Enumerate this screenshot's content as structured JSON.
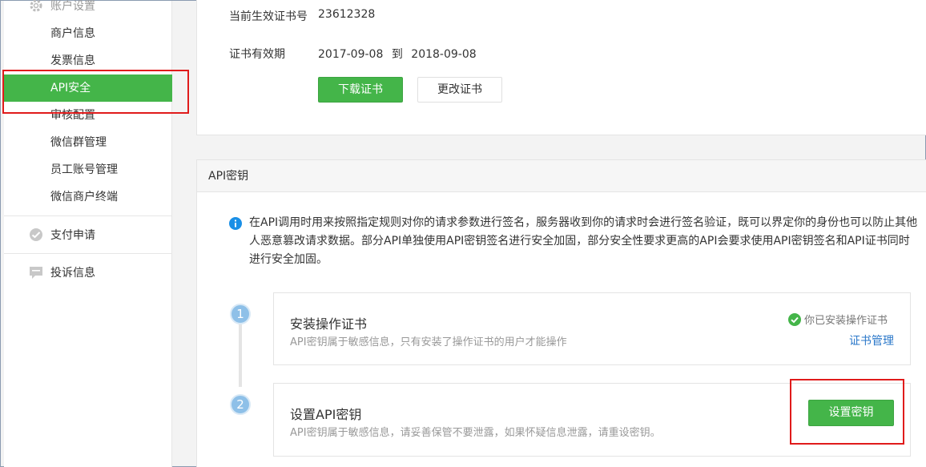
{
  "sidebar": {
    "group_account": "账户设置",
    "items": [
      {
        "label": "商户信息"
      },
      {
        "label": "发票信息"
      },
      {
        "label": "API安全"
      },
      {
        "label": "审核配置"
      },
      {
        "label": "微信群管理"
      },
      {
        "label": "员工账号管理"
      },
      {
        "label": "微信商户终端"
      }
    ],
    "group_payment": "支付申请",
    "group_complaint": "投诉信息"
  },
  "cert": {
    "number_label": "当前生效证书号",
    "number_value": "23612328",
    "validity_label": "证书有效期",
    "validity_start": "2017-09-08",
    "validity_to": "到",
    "validity_end": "2018-09-08",
    "download_button": "下载证书",
    "change_button": "更改证书"
  },
  "apikey": {
    "section_title": "API密钥",
    "info": "在API调用时用来按照指定规则对你的请求参数进行签名，服务器收到你的请求时会进行签名验证，既可以界定你的身份也可以防止其他人恶意篡改请求数据。部分API单独使用API密钥签名进行安全加固，部分安全性要求更高的API会要求使用API密钥签名和API证书同时进行安全加固。",
    "steps": [
      {
        "number": "1",
        "title": "安装操作证书",
        "desc": "API密钥属于敏感信息，只有安装了操作证书的用户才能操作",
        "status": "你已安装操作证书",
        "link": "证书管理"
      },
      {
        "number": "2",
        "title": "设置API密钥",
        "desc": "API密钥属于敏感信息，请妥善保管不要泄露，如果怀疑信息泄露，请重设密钥。",
        "button": "设置密钥"
      }
    ]
  },
  "colors": {
    "accent": "#44b549",
    "highlight": "#e01b1b",
    "info": "#1a8fe6",
    "link": "#2a77c9"
  }
}
